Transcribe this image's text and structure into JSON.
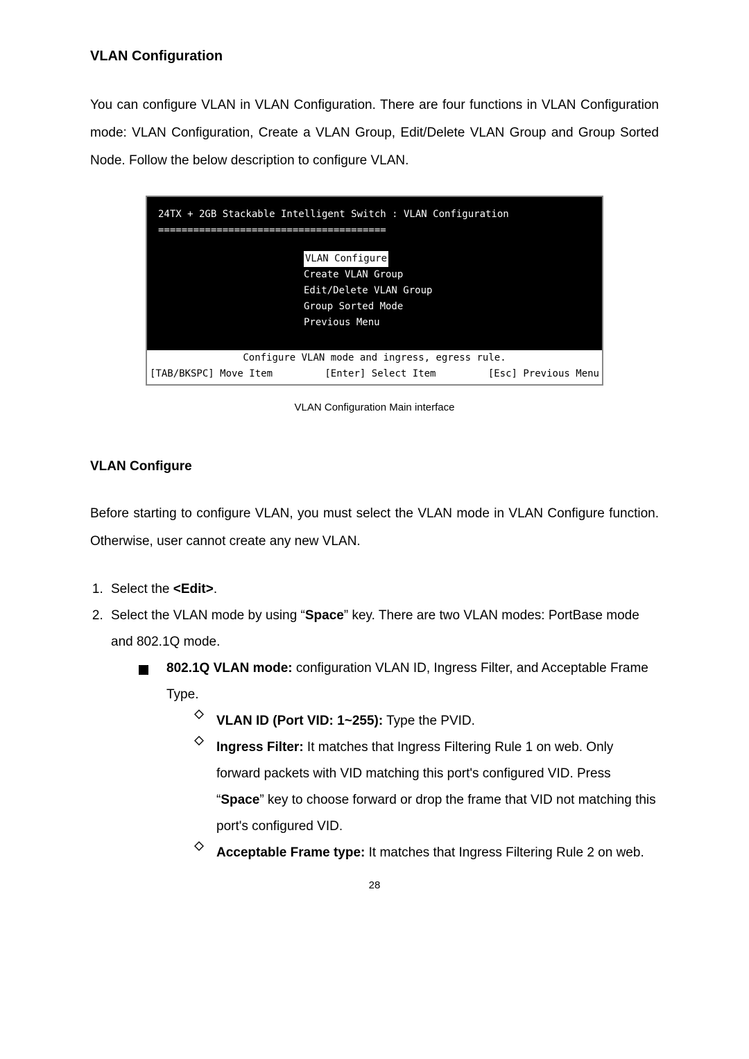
{
  "heading": "VLAN Configuration",
  "intro": "You can configure VLAN in VLAN Configuration. There are four functions in VLAN Configuration mode: VLAN Configuration, Create a VLAN Group, Edit/Delete VLAN Group and Group Sorted Node. Follow the below description to configure VLAN.",
  "terminal": {
    "title": "24TX + 2GB Stackable Intelligent Switch : VLAN Configuration",
    "rule": "=======================================",
    "menu": {
      "selected": "VLAN Configure",
      "items": [
        "Create VLAN Group",
        "Edit/Delete VLAN Group",
        "Group Sorted Mode",
        "Previous Menu"
      ]
    },
    "status_top": "Configure VLAN mode and ingress, egress rule.",
    "status_left": "[TAB/BKSPC] Move Item",
    "status_mid": "[Enter] Select Item",
    "status_right": "[Esc] Previous Menu"
  },
  "caption": "VLAN Configuration Main interface",
  "section2_title": "VLAN Configure",
  "section2_intro": "Before starting to configure VLAN, you must select the VLAN mode in VLAN Configure function. Otherwise, user cannot create any new VLAN.",
  "steps": {
    "s1_pre": "Select the ",
    "s1_bold": "<Edit>",
    "s1_post": ".",
    "s2_pre": "Select the VLAN mode by using “",
    "s2_bold": "Space",
    "s2_post": "” key. There are two VLAN modes: PortBase mode and 802.1Q mode."
  },
  "bullet_main": {
    "lead_bold": "802.1Q VLAN mode:",
    "tail": " configuration VLAN ID, Ingress Filter, and Acceptable Frame Type."
  },
  "diamonds": {
    "d1_bold": "VLAN ID (Port VID: 1~255):",
    "d1_tail": " Type the PVID.",
    "d2_bold": "Ingress Filter:",
    "d2_tail_a": " It matches that Ingress Filtering Rule 1 on web. Only forward packets with VID matching this port's configured VID. Press “",
    "d2_space": "Space",
    "d2_tail_b": "” key to choose forward or drop the frame that VID not matching this port's configured VID.",
    "d3_bold": "Acceptable Frame type:",
    "d3_tail": " It matches that Ingress Filtering Rule 2 on web."
  },
  "page_number": "28"
}
